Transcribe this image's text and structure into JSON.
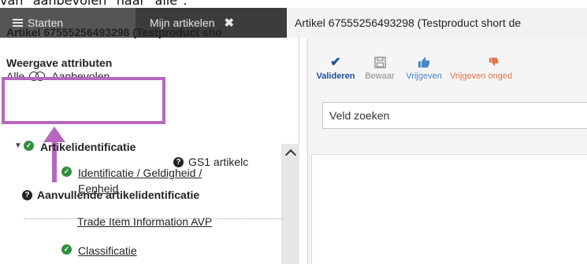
{
  "caption": "van \"aanbevolen\" naar \"alle\".",
  "tabs": {
    "start_label": "Starten",
    "mine_label": "Mijn artikelen",
    "mine_close": "✖",
    "article_label": "Artikel 67555256493298 (Testproduct short de"
  },
  "left_panel": {
    "title": "Artikel 67555256493298 (Testproduct sho",
    "attributes_heading": "Weergave attributen",
    "attributes_all": "Alle",
    "attributes_recommended": "Aanbevolen",
    "tree": [
      {
        "label": "Artikelidentificatie",
        "level": 0,
        "checked": true,
        "expanded": true
      },
      {
        "label_line1": "Identificatie / Geldigheid /",
        "label_line2": "Eenheid",
        "level": 1,
        "checked": true
      },
      {
        "label": "Trade Item Information AVP",
        "level": 1,
        "checked": false
      },
      {
        "label": "Classificatie",
        "level": 1,
        "checked": true
      }
    ]
  },
  "toolbar": {
    "validate": "Valideren",
    "save": "Bewaar",
    "release": "Vrijgeven",
    "release_unchanged": "Vrijgeven onged"
  },
  "search": {
    "value": "Veld zoeken"
  },
  "content": {
    "gs1_label": "GS1 artikelc",
    "section_title": "Aanvullende artikelidentificatie"
  },
  "colors": {
    "highlight": "#b667bf",
    "check_green": "#2f8f3f",
    "validate_blue": "#1b4f9c",
    "release_blue": "#4a86c8",
    "release_unchanged_orange": "#e2734a"
  }
}
